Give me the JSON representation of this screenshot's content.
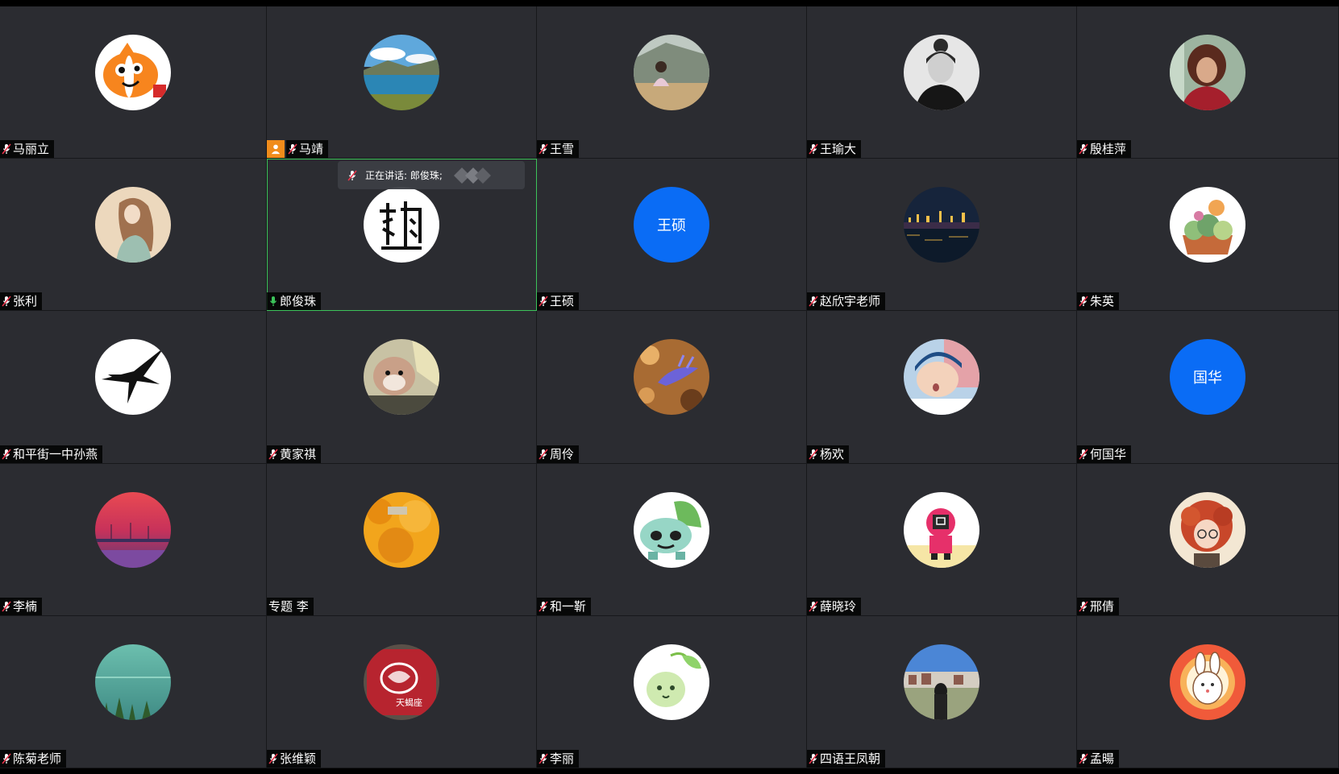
{
  "speaking_banner": "正在讲话: 郎俊珠;",
  "colors": {
    "tile_bg": "#2b2c31",
    "text_avatar_bg": "#0a6cf5",
    "active_border": "#3cc35a",
    "mic_active": "#3cc35a",
    "mic_muted": "#e8334a",
    "host_badge": "#f08c1b"
  },
  "participants": [
    {
      "name": "马丽立",
      "avatar": "clownfish",
      "mic": "muted"
    },
    {
      "name": "马靖",
      "avatar": "lake-landscape",
      "mic": "muted",
      "host": true
    },
    {
      "name": "王雪",
      "avatar": "girl-photo",
      "mic": "muted"
    },
    {
      "name": "王瑜大",
      "avatar": "bw-portrait",
      "mic": "muted"
    },
    {
      "name": "殷桂萍",
      "avatar": "woman-portrait",
      "mic": "muted"
    },
    {
      "name": "张利",
      "avatar": "girl-illustration",
      "mic": "muted"
    },
    {
      "name": "郎俊珠",
      "avatar": "calligraphy-seal",
      "mic": "active",
      "speaking": true
    },
    {
      "name": "王硕",
      "avatar_text": "王硕",
      "mic": "muted"
    },
    {
      "name": "赵欣宇老师",
      "avatar": "night-city",
      "mic": "muted"
    },
    {
      "name": "朱英",
      "avatar": "succulents",
      "mic": "muted"
    },
    {
      "name": "和平街一中孙燕",
      "avatar": "swallow-logo",
      "mic": "muted"
    },
    {
      "name": "黄家祺",
      "avatar": "hamster-plush",
      "mic": "muted"
    },
    {
      "name": "周伶",
      "avatar": "sea-slug",
      "mic": "muted"
    },
    {
      "name": "杨欢",
      "avatar": "baby",
      "mic": "muted"
    },
    {
      "name": "何国华",
      "avatar_text": "国华",
      "mic": "muted"
    },
    {
      "name": "李楠",
      "avatar": "sunset",
      "mic": "muted"
    },
    {
      "name": "专题 李",
      "avatar": "autumn-tree",
      "mic": "none"
    },
    {
      "name": "和一靳",
      "avatar": "bulbasaur",
      "mic": "muted"
    },
    {
      "name": "薛晓玲",
      "avatar": "squid-guard",
      "mic": "muted"
    },
    {
      "name": "邢倩",
      "avatar": "red-hair-girl",
      "mic": "muted"
    },
    {
      "name": "陈菊老师",
      "avatar": "green-sea",
      "mic": "muted"
    },
    {
      "name": "张维颖",
      "avatar": "red-sign",
      "mic": "muted"
    },
    {
      "name": "李丽",
      "avatar": "leaf-sprite",
      "mic": "muted"
    },
    {
      "name": "四语王凤朝",
      "avatar": "city-back",
      "mic": "muted"
    },
    {
      "name": "孟暘",
      "avatar": "bunny-sun",
      "mic": "muted"
    }
  ]
}
